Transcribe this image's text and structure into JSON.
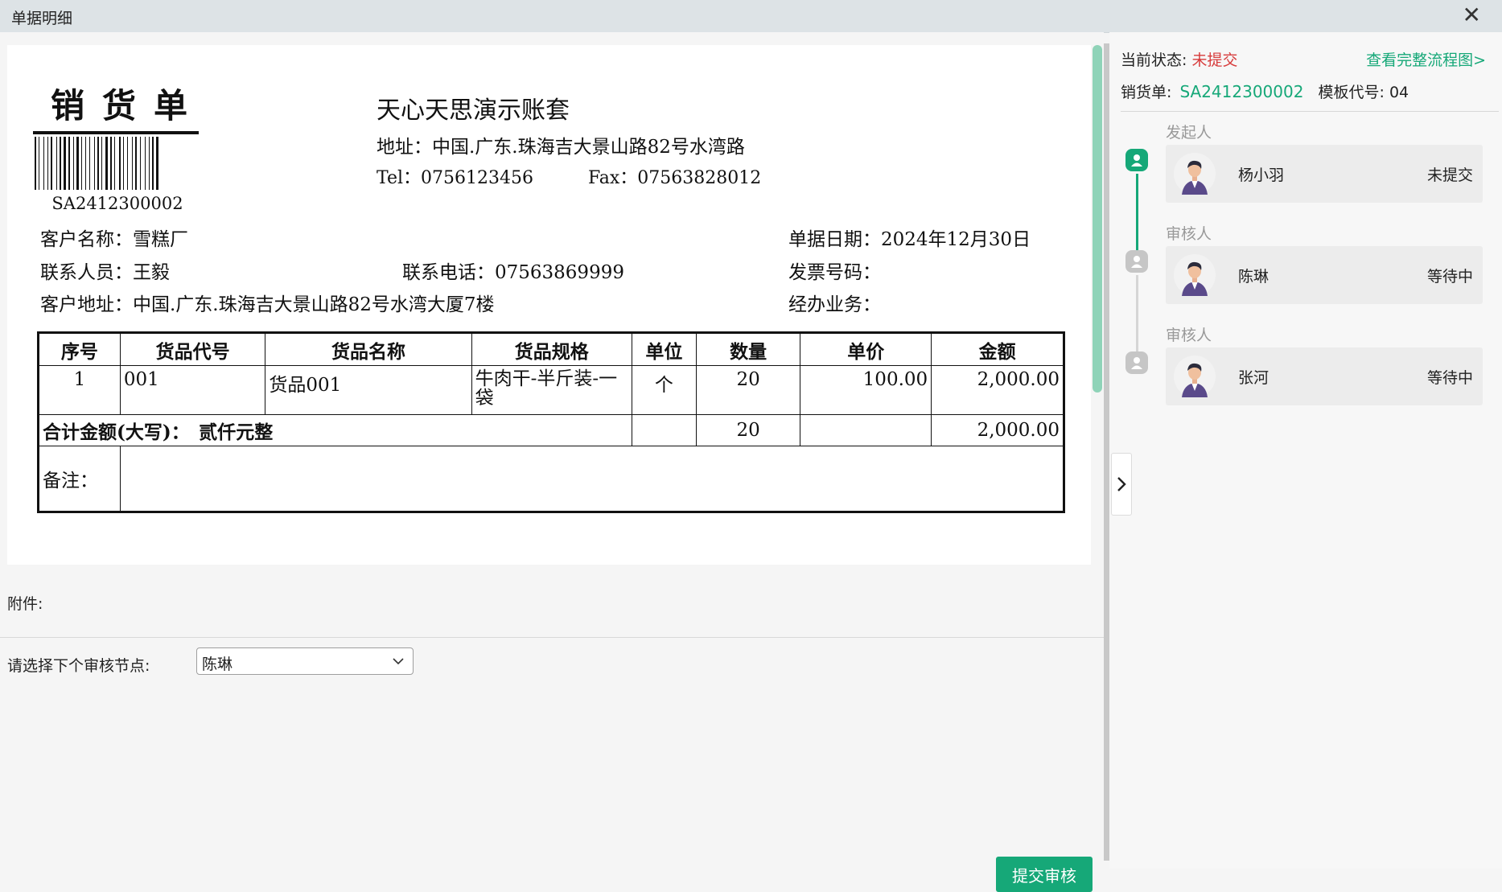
{
  "window": {
    "title": "单据明细"
  },
  "document": {
    "doc_title": "销货单",
    "barcode_text": "SA2412300002",
    "company": "天心天思演示账套",
    "address": "地址：中国.广东.珠海吉大景山路82号水湾路",
    "tel": "Tel：0756123456",
    "fax": "Fax：07563828012",
    "customer_name": "客户名称：雪糕厂",
    "doc_date": "单据日期：2024年12月30日",
    "contact": "联系人员：王毅",
    "phone": "联系电话：07563869999",
    "invoice_no": "发票号码：",
    "customer_address": "客户地址：中国.广东.珠海吉大景山路82号水湾大厦7楼",
    "handler": "经办业务：",
    "table": {
      "headers": [
        "序号",
        "货品代号",
        "货品名称",
        "货品规格",
        "单位",
        "数量",
        "单价",
        "金额"
      ],
      "rows": [
        [
          "1",
          "001",
          "货品001",
          "牛肉干-半斤装-一袋",
          "个",
          "20",
          "100.00",
          "2,000.00"
        ]
      ],
      "total_label": "合计金额(大写)：　贰仟元整",
      "total_qty": "20",
      "total_amount": "2,000.00",
      "remark_label": "备注："
    }
  },
  "attachments_label": "附件:",
  "next_node": {
    "label": "请选择下个审核节点:",
    "selected": "陈琳"
  },
  "submit_label": "提交审核",
  "panel": {
    "status_label": "当前状态:",
    "status_value": "未提交",
    "status_color": "#d73b3b",
    "flow_link": "查看完整流程图>",
    "doc_label": "销货单:",
    "doc_no": "SA2412300002",
    "template_label": "模板代号:",
    "template_no": "04",
    "accent": "#16a878",
    "nodes": [
      {
        "role": "发起人",
        "name": "杨小羽",
        "state": "未提交",
        "active": true
      },
      {
        "role": "审核人",
        "name": "陈琳",
        "state": "等待中",
        "active": false
      },
      {
        "role": "审核人",
        "name": "张河",
        "state": "等待中",
        "active": false
      }
    ]
  }
}
